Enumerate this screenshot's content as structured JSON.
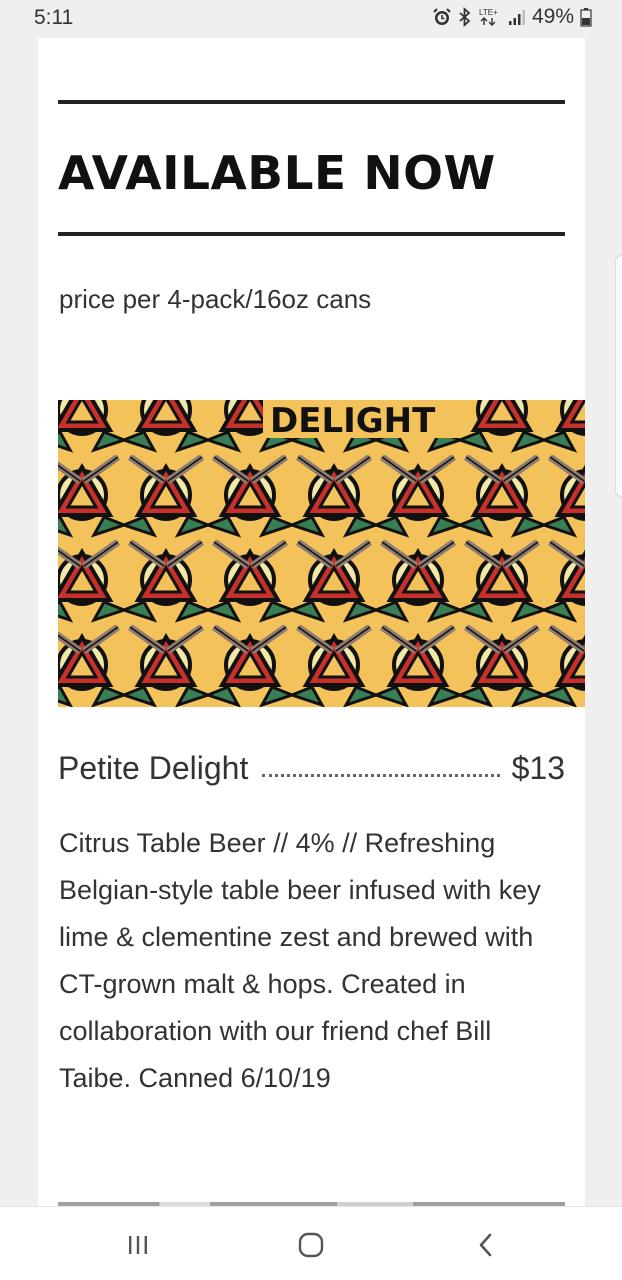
{
  "status_bar": {
    "time": "5:11",
    "network": "LTE+",
    "battery": "49%"
  },
  "menu": {
    "heading": "AVAILABLE NOW",
    "price_note": "price per 4-pack/16oz cans",
    "item": {
      "image_label": "DELIGHT",
      "name": "Petite Delight",
      "price": "$13",
      "description": "Citrus Table Beer // 4% // Refreshing Belgian-style table beer infused with key lime & clementine zest and brewed with CT-grown malt & hops. Created in collaboration with our friend chef Bill Taibe. Canned 6/10/19"
    }
  },
  "nav": {
    "recent_icon": "recent-apps-icon",
    "home_icon": "home-icon",
    "back_icon": "back-icon"
  },
  "colors": {
    "label_bg": "#f3c25b",
    "red": "#c8302c",
    "green": "#3a7e55",
    "cream": "#f2e9a6",
    "taupe": "#8c7b70"
  }
}
